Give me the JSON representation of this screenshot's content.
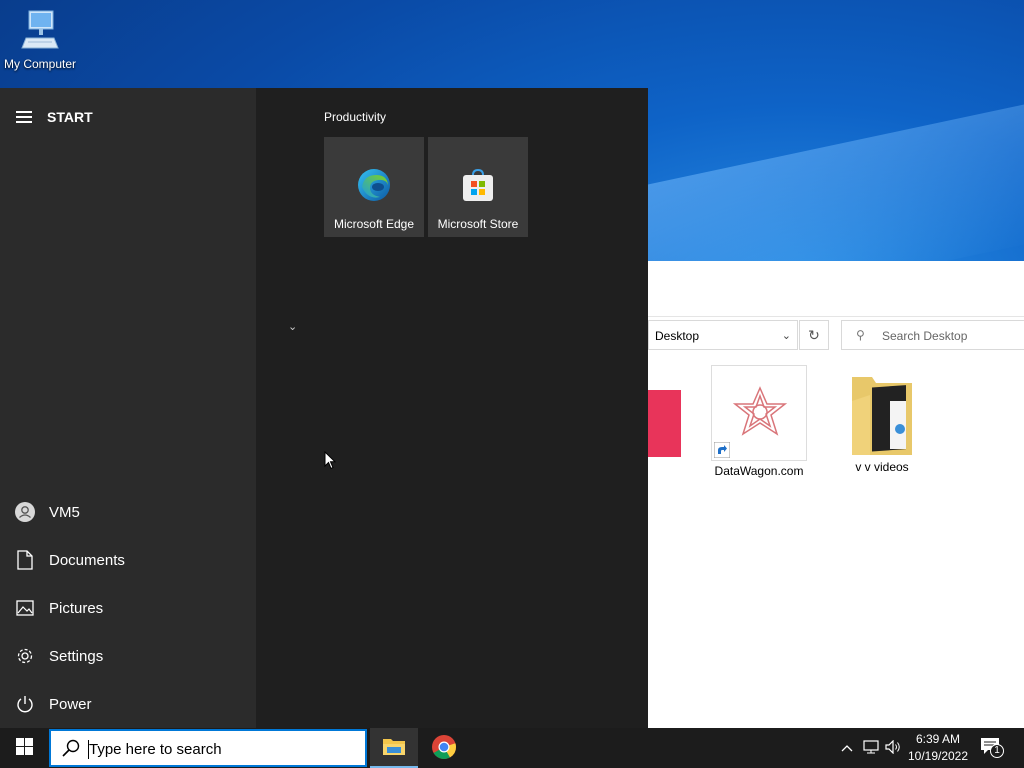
{
  "desktop": {
    "icons": [
      {
        "label": "My Computer",
        "icon": "computer-icon"
      }
    ]
  },
  "explorer": {
    "address": "Desktop",
    "search_placeholder": "Search Desktop",
    "files": [
      {
        "name": "DataWagon.com",
        "icon": "shortcut-icon"
      },
      {
        "name": "v v videos",
        "icon": "folder-icon"
      }
    ]
  },
  "start_menu": {
    "title": "START",
    "nav": [
      {
        "label": "VM5",
        "icon": "user-avatar-icon"
      },
      {
        "label": "Documents",
        "icon": "document-icon"
      },
      {
        "label": "Pictures",
        "icon": "pictures-icon"
      },
      {
        "label": "Settings",
        "icon": "gear-icon"
      },
      {
        "label": "Power",
        "icon": "power-icon"
      }
    ],
    "group_title": "Productivity",
    "tiles": [
      {
        "label": "Microsoft Edge",
        "icon": "edge-icon"
      },
      {
        "label": "Microsoft Store",
        "icon": "store-icon"
      }
    ]
  },
  "taskbar": {
    "search_placeholder": "Type here to search",
    "apps": [
      {
        "name": "File Explorer",
        "icon": "file-explorer-icon",
        "active": true
      },
      {
        "name": "Google Chrome",
        "icon": "chrome-icon",
        "active": false
      }
    ],
    "clock": {
      "time": "6:39 AM",
      "date": "10/19/2022"
    },
    "notification_count": "1"
  },
  "colors": {
    "accent": "#0078d7",
    "start_bg": "#1f1f1f",
    "start_left_bg": "#2b2b2b",
    "tile_bg": "#3a3a3a",
    "taskbar_bg": "#1c1c1c"
  }
}
